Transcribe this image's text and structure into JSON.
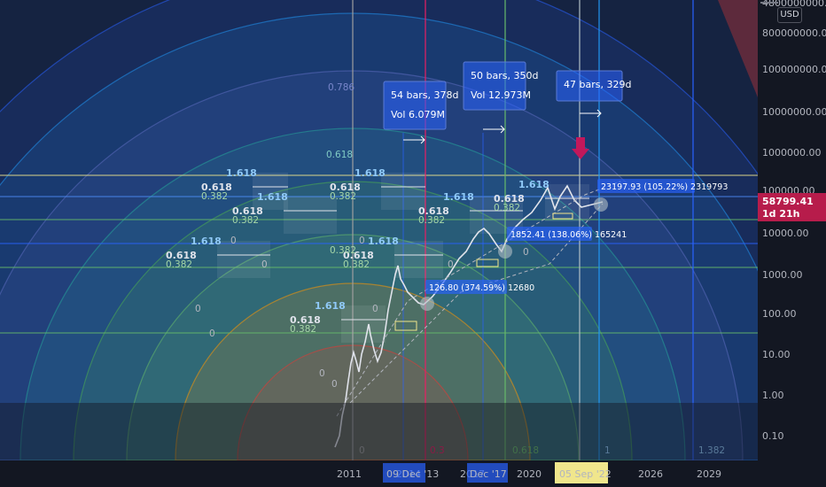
{
  "price_axis": {
    "currency": "USD",
    "ticks": [
      "4800000000.00",
      "800000000.00",
      "100000000.00",
      "10000000.00",
      "1000000.00",
      "100000.00",
      "10000.00",
      "1000.00",
      "100.00",
      "10.00",
      "1.00",
      "0.10"
    ],
    "current_price": "58799.41",
    "countdown": "1d 21h"
  },
  "time_axis": {
    "ticks": [
      "2011",
      "2014",
      "2017",
      "2020",
      "2026",
      "2029"
    ],
    "highlight_start": "09 Dec '13",
    "highlight_mid": "Dec '17",
    "highlight_end": "05 Sep '22"
  },
  "fib_time_labels": [
    "0",
    "0.3",
    "0.618",
    "1",
    "1.382"
  ],
  "fib_levels": [
    "1.618",
    "0.618",
    "0.382",
    "0",
    "0.786"
  ],
  "callouts": [
    {
      "line1": "54 bars, 378d",
      "line2": "Vol 6.079M"
    },
    {
      "line1": "50 bars, 350d",
      "line2": "Vol 12.973M"
    },
    {
      "line1": "47 bars, 329d",
      "line2": ""
    }
  ],
  "measure_labels": [
    "23197.93 (105.22%) 2319793",
    "1852.41 (138.06%) 165241",
    "126.80 (374.59%) 12680"
  ],
  "colors": {
    "background": "#131722",
    "chart_area": "#152341",
    "accent_blue": "#2962ff",
    "price_tag": "#b71c4b",
    "fib_red": "#e53935",
    "fib_orange": "#ff9800",
    "fib_green": "#4caf50",
    "fib_teal": "#26a69a",
    "fib_blue": "#2196f3",
    "yellow_line": "#f0e68c"
  },
  "icons": {
    "arrow_down": "arrow-down-icon",
    "measure_arrow": "arrow-right-icon"
  }
}
